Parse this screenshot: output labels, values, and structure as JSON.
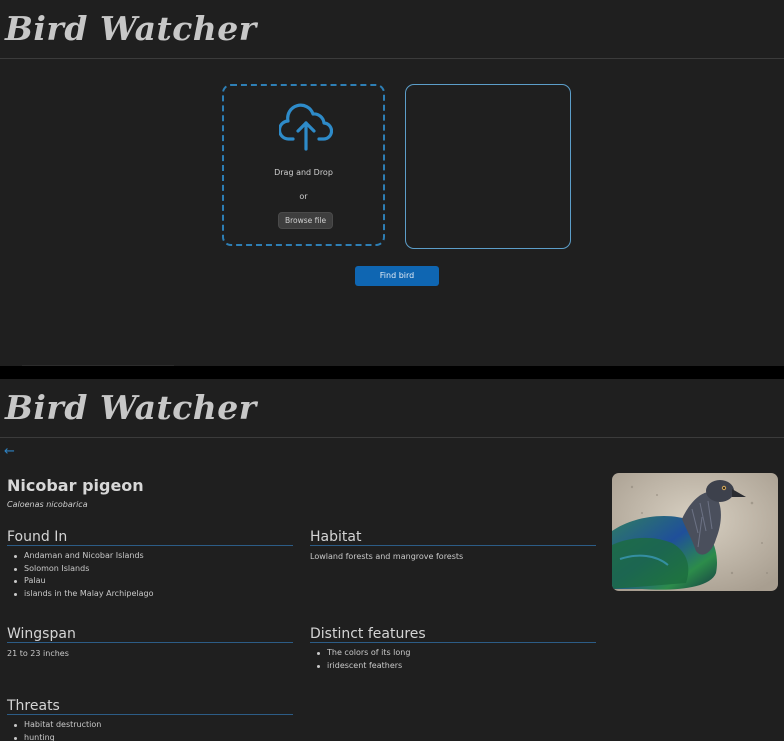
{
  "upload_screen": {
    "app_title": "Bird Watcher",
    "drop_zone": {
      "drag_text": "Drag and Drop",
      "or_text": "or",
      "browse_label": "Browse file"
    },
    "find_label": "Find bird"
  },
  "result_screen": {
    "app_title": "Bird Watcher",
    "back_glyph": "←",
    "bird": {
      "common_name": "Nicobar pigeon",
      "scientific_name": "Caloenas nicobarica"
    },
    "found_in": {
      "title": "Found In",
      "items": [
        "Andaman and Nicobar Islands",
        "Solomon Islands",
        "Palau",
        "islands in the Malay Archipelago"
      ]
    },
    "habitat": {
      "title": "Habitat",
      "text": "Lowland forests and mangrove forests"
    },
    "wingspan": {
      "title": "Wingspan",
      "text": "21 to 23 inches"
    },
    "distinct_features": {
      "title": "Distinct features",
      "items": [
        "The colors of its long",
        "iridescent feathers"
      ]
    },
    "threats": {
      "title": "Threats",
      "items": [
        "Habitat destruction",
        "hunting"
      ]
    }
  },
  "colors": {
    "accent": "#0f66b2",
    "accent_border": "#2e7fb5",
    "background": "#1f1f1f",
    "section_rule": "#2c5c86"
  }
}
